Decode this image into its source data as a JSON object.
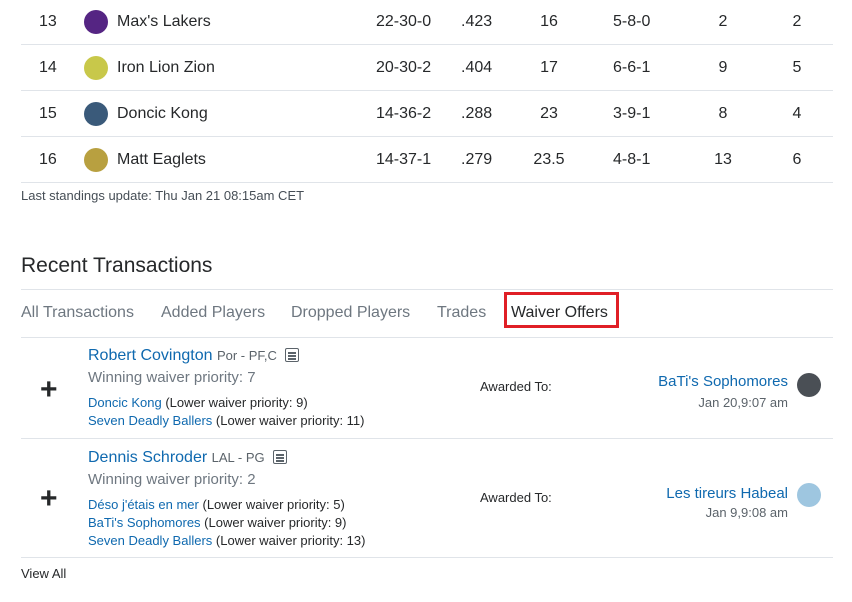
{
  "standings": [
    {
      "rank": "13",
      "team": "Max's Lakers",
      "record": "22-30-0",
      "pct": ".423",
      "gb": "16",
      "streak": "5-8-0",
      "c6": "2",
      "c7": "2",
      "logo_color": "#552583"
    },
    {
      "rank": "14",
      "team": "Iron Lion Zion",
      "record": "20-30-2",
      "pct": ".404",
      "gb": "17",
      "streak": "6-6-1",
      "c6": "9",
      "c7": "5",
      "logo_color": "#c8c84a"
    },
    {
      "rank": "15",
      "team": "Doncic Kong",
      "record": "14-36-2",
      "pct": ".288",
      "gb": "23",
      "streak": "3-9-1",
      "c6": "8",
      "c7": "4",
      "logo_color": "#3a5a7a"
    },
    {
      "rank": "16",
      "team": "Matt Eaglets",
      "record": "14-37-1",
      "pct": ".279",
      "gb": "23.5",
      "streak": "4-8-1",
      "c6": "13",
      "c7": "6",
      "logo_color": "#b8a040"
    }
  ],
  "last_update": "Last standings update: Thu Jan 21 08:15am CET",
  "recent": {
    "title": "Recent Transactions",
    "tabs": [
      "All Transactions",
      "Added Players",
      "Dropped Players",
      "Trades",
      "Waiver Offers"
    ],
    "active_tab": "Waiver Offers",
    "transactions": [
      {
        "player": "Robert Covington",
        "pos": "Por - PF,C",
        "priority": "Winning waiver priority: 7",
        "losers": [
          {
            "team": "Doncic Kong",
            "detail": " (Lower waiver priority: 9)"
          },
          {
            "team": "Seven Deadly Ballers",
            "detail": " (Lower waiver priority: 11)"
          }
        ],
        "awarded_label": "Awarded To:",
        "winner": "BaTi's Sophomores",
        "date": "Jan 20,9:07 am"
      },
      {
        "player": "Dennis Schroder",
        "pos": "LAL - PG",
        "priority": "Winning waiver priority: 2",
        "losers": [
          {
            "team": "Déso j'étais en mer",
            "detail": " (Lower waiver priority: 5)"
          },
          {
            "team": "BaTi's Sophomores",
            "detail": " (Lower waiver priority: 9)"
          },
          {
            "team": "Seven Deadly Ballers",
            "detail": " (Lower waiver priority: 13)"
          }
        ],
        "awarded_label": "Awarded To:",
        "winner": "Les tireurs Habeal",
        "date": "Jan 9,9:08 am"
      }
    ],
    "plus_glyph": "+",
    "view_all": "View All"
  },
  "colors": {
    "link": "#0f69af",
    "highlight": "#e01f26"
  }
}
